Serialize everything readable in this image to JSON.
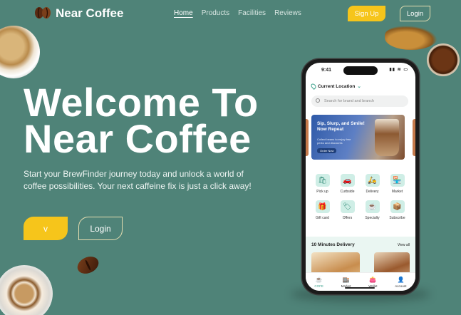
{
  "header": {
    "brand": "Near Coffee",
    "nav": [
      "Home",
      "Products",
      "Facilities",
      "Reviews"
    ],
    "signup_label": "Sign Up",
    "login_label": "Login"
  },
  "hero": {
    "title_line1": "Welcome To",
    "title_line2": "Near Coffee",
    "description": "Start your BrewFinder journey today and unlock a world of coffee possibilities. Your next caffeine fix is just a click away!",
    "cta_label": "v",
    "login_label": "Login"
  },
  "phone": {
    "time": "9:41",
    "status_icons": "▮▮ ≋ ▭",
    "location_label": "Current Location",
    "search_placeholder": "Search for brand and branch",
    "banner": {
      "title": "Sip, Slurp, and Smile! Now Repeat",
      "subtitle": "Collect beans to enjoy free perks and discounts",
      "button": "Order Now"
    },
    "categories": [
      {
        "icon": "pickup-icon",
        "glyph": "🛍",
        "label": "Pick up"
      },
      {
        "icon": "curbside-icon",
        "glyph": "🚗",
        "label": "Curbside"
      },
      {
        "icon": "delivery-icon",
        "glyph": "🛵",
        "label": "Delivery"
      },
      {
        "icon": "market-icon",
        "glyph": "🏪",
        "label": "Market"
      },
      {
        "icon": "gift-card-icon",
        "glyph": "🎁",
        "label": "Gift card"
      },
      {
        "icon": "offers-icon",
        "glyph": "🏷",
        "label": "Offers"
      },
      {
        "icon": "specialty-icon",
        "glyph": "☕",
        "label": "Specialty"
      },
      {
        "icon": "subscribe-icon",
        "glyph": "📦",
        "label": "Subscribe"
      }
    ],
    "delivery_title": "10 Minutes Delivery",
    "view_all": "View all",
    "tabs": [
      {
        "icon": "coffee-icon",
        "glyph": "☕",
        "label": "COFE",
        "active": true
      },
      {
        "icon": "market-icon",
        "glyph": "🏬",
        "label": "Market",
        "active": false
      },
      {
        "icon": "wallet-icon",
        "glyph": "👛",
        "label": "Wallet",
        "active": false
      },
      {
        "icon": "account-icon",
        "glyph": "👤",
        "label": "Account",
        "active": false
      }
    ]
  },
  "colors": {
    "background": "#4f8378",
    "accent": "#f6c51b",
    "outline": "#e5ddb0"
  }
}
